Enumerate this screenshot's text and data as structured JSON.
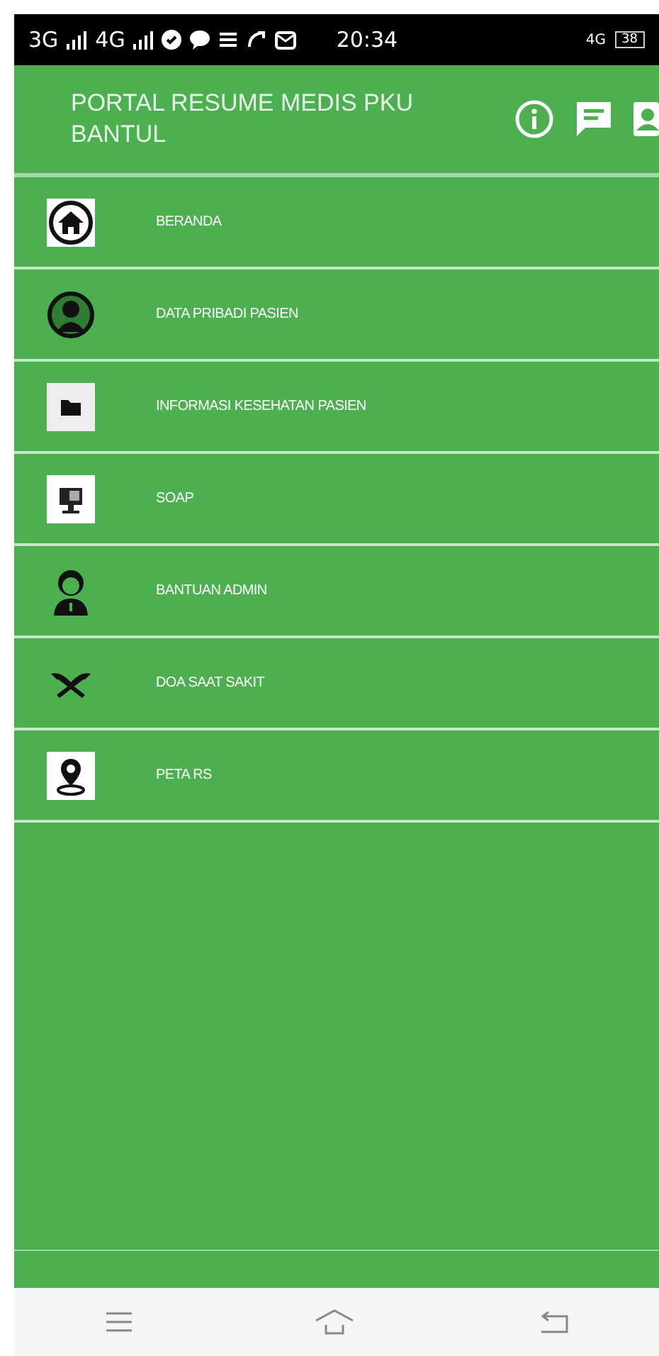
{
  "status_bar": {
    "network_1": "3G",
    "network_2": "4G",
    "time": "20:34",
    "network_3": "4G",
    "battery": "38"
  },
  "header": {
    "title": "PORTAL RESUME MEDIS PKU BANTUL"
  },
  "menu": [
    {
      "label": "BERANDA",
      "kind": "home"
    },
    {
      "label": "DATA PRIBADI PASIEN",
      "kind": "person"
    },
    {
      "label": "INFORMASI KESEHATAN PASIEN",
      "kind": "folder"
    },
    {
      "label": "SOAP",
      "kind": "monitor"
    },
    {
      "label": "BANTUAN ADMIN",
      "kind": "admin"
    },
    {
      "label": "DOA SAAT SAKIT",
      "kind": "book"
    },
    {
      "label": "PETA RS",
      "kind": "pin"
    }
  ]
}
